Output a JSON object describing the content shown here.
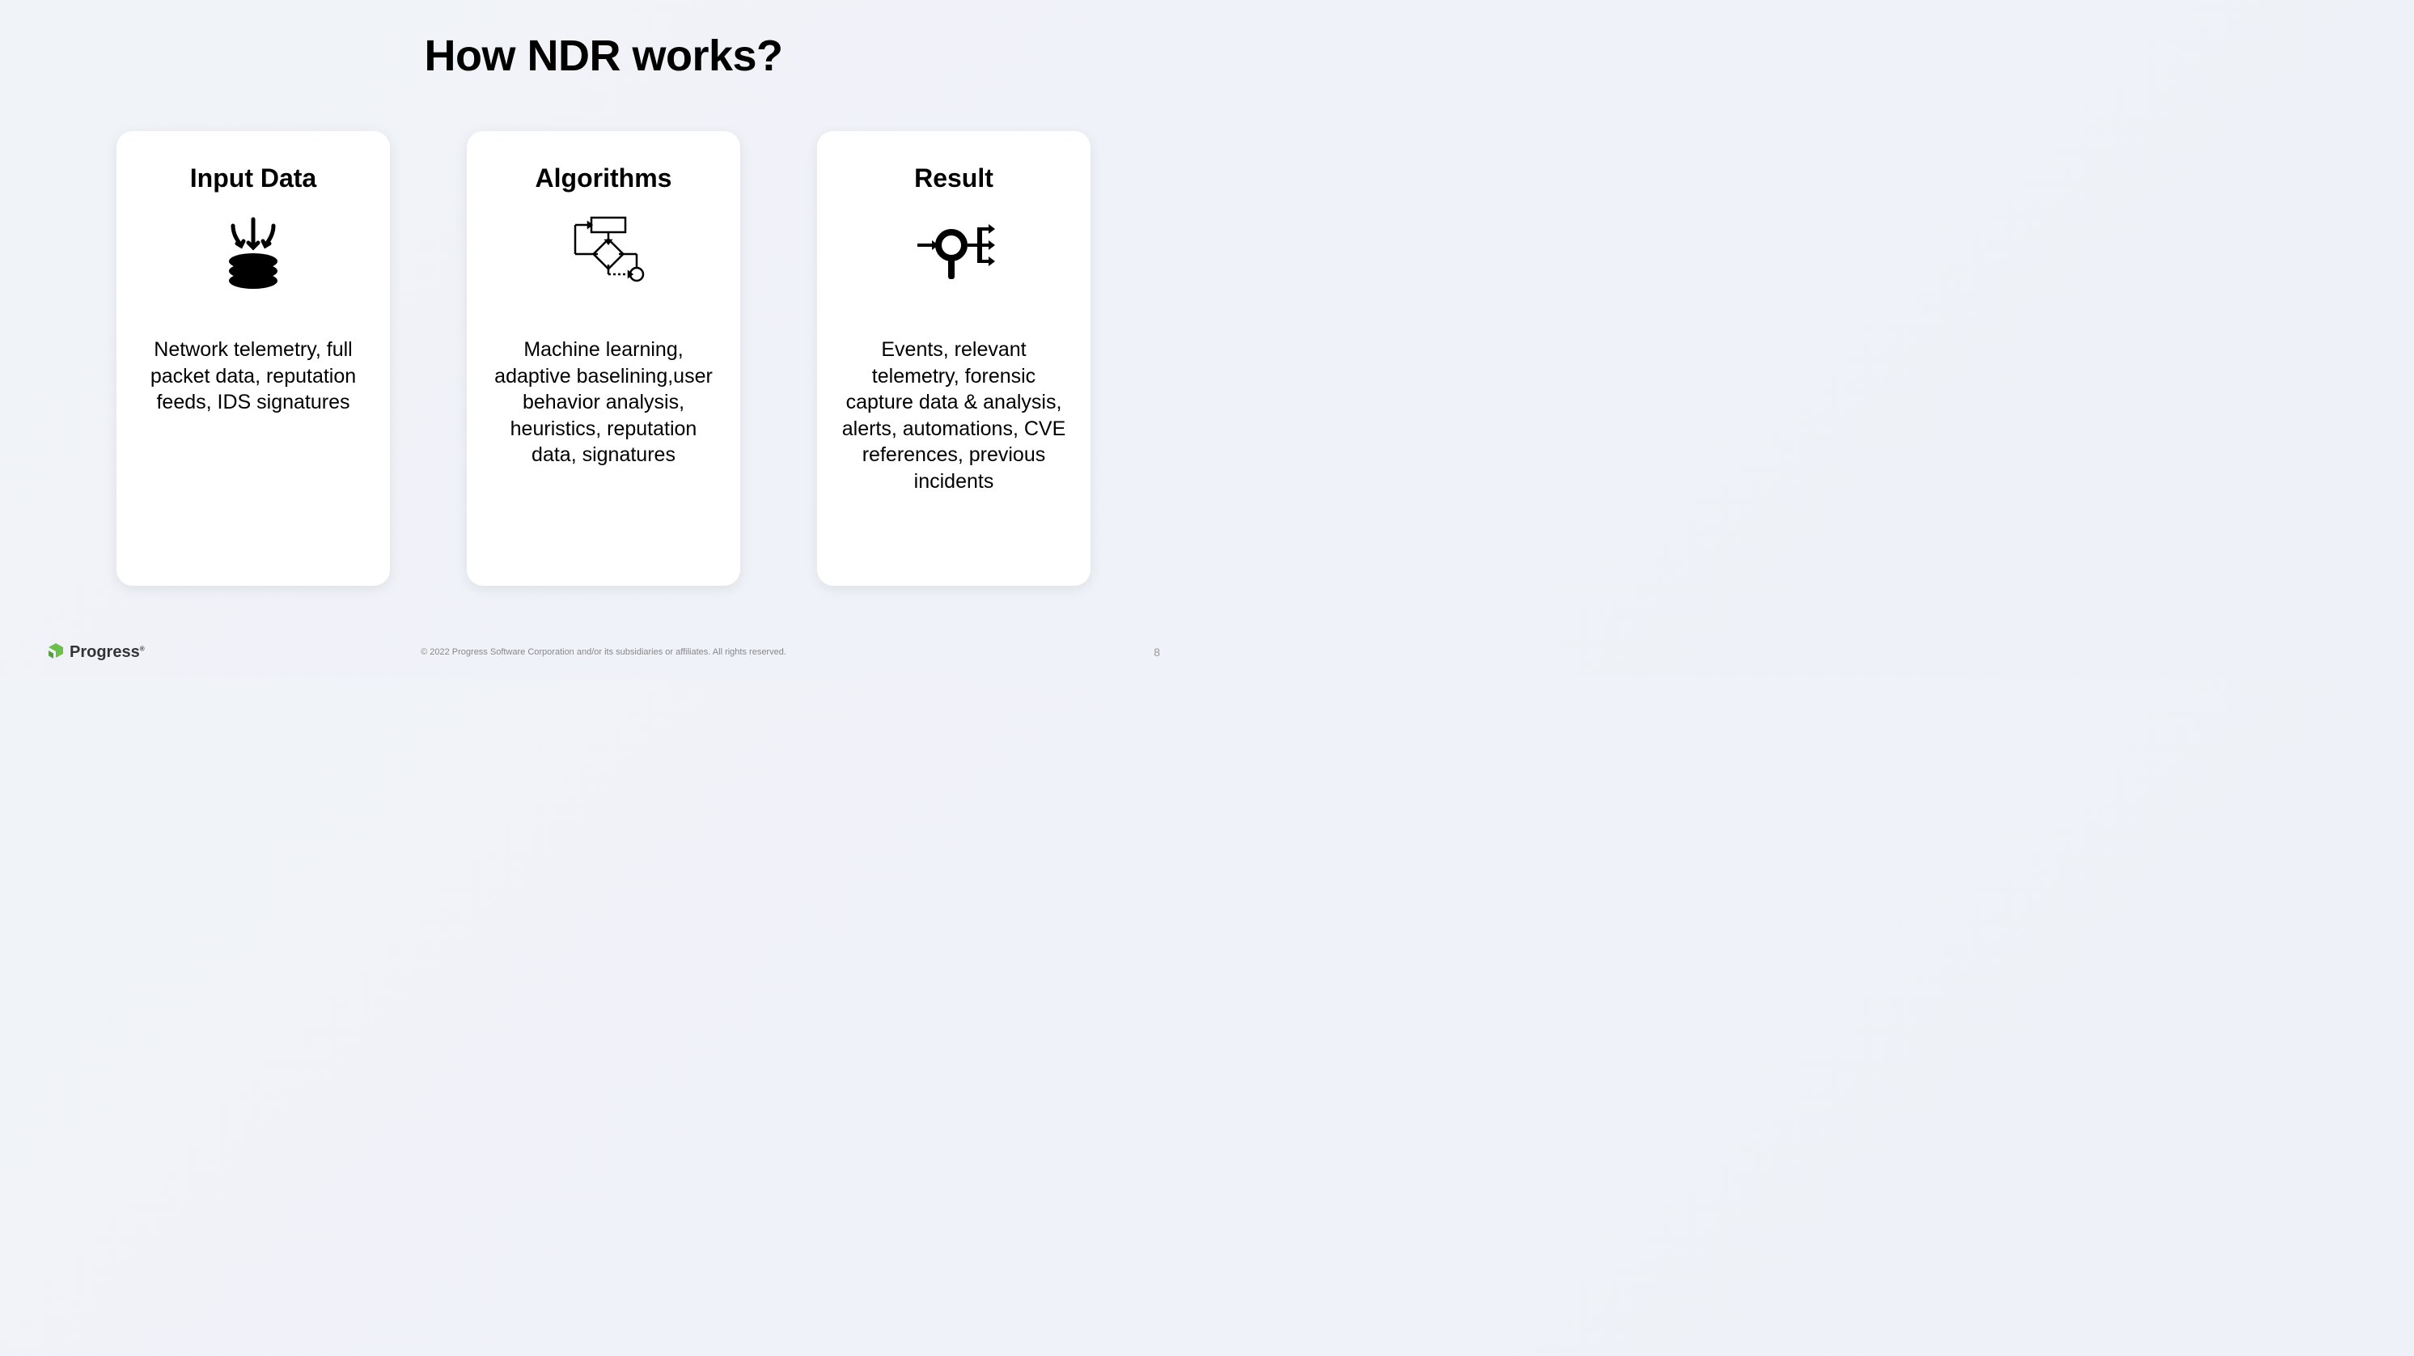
{
  "title": "How NDR works?",
  "cards": [
    {
      "title": "Input Data",
      "body": "Network telemetry, full packet data, reputation feeds, IDS signatures",
      "icon": "data-ingest-icon"
    },
    {
      "title": "Algorithms",
      "body": "Machine learning, adaptive baselining,user behavior analysis, heuristics, reputation data, signatures",
      "icon": "flowchart-icon"
    },
    {
      "title": "Result",
      "body": "Events, relevant telemetry, forensic capture data & analysis,  alerts, automations, CVE references, previous incidents",
      "icon": "search-branch-icon"
    }
  ],
  "footer": {
    "brand": "Progress",
    "copyright": "© 2022 Progress Software Corporation and/or its subsidiaries or affiliates. All rights reserved.",
    "page": "8"
  }
}
